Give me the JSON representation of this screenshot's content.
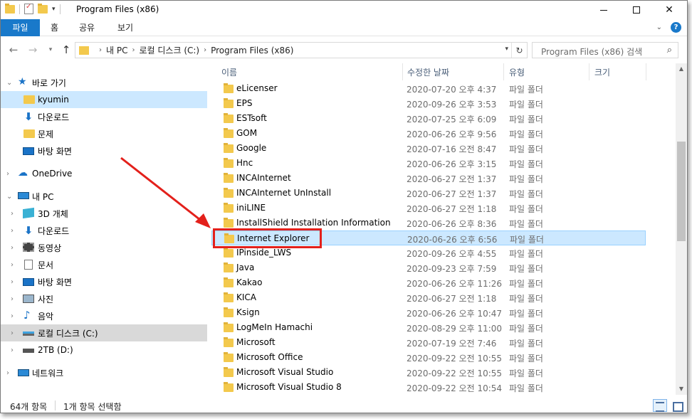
{
  "window": {
    "title": "Program Files (x86)"
  },
  "ribbon": {
    "tabs": [
      "파일",
      "홈",
      "공유",
      "보기"
    ]
  },
  "address": {
    "crumbs": [
      "내 PC",
      "로컬 디스크 (C:)",
      "Program Files (x86)"
    ],
    "search_placeholder": "Program Files (x86) 검색"
  },
  "nav": {
    "quick_access": "바로 가기",
    "quick_items": [
      "kyumin",
      "다운로드",
      "문제",
      "바탕 화면"
    ],
    "onedrive": "OneDrive",
    "this_pc": "내 PC",
    "pc_items": [
      "3D 개체",
      "다운로드",
      "동영상",
      "문서",
      "바탕 화면",
      "사진",
      "음악",
      "로컬 디스크 (C:)",
      "2TB (D:)"
    ],
    "network": "네트워크"
  },
  "columns": {
    "name": "이름",
    "date": "수정한 날짜",
    "type": "유형",
    "size": "크기"
  },
  "files": [
    {
      "name": "eLicenser",
      "date": "2020-07-20 오후 4:37",
      "type": "파일 폴더"
    },
    {
      "name": "EPS",
      "date": "2020-09-26 오후 3:53",
      "type": "파일 폴더"
    },
    {
      "name": "ESTsoft",
      "date": "2020-07-25 오후 6:09",
      "type": "파일 폴더"
    },
    {
      "name": "GOM",
      "date": "2020-06-26 오후 9:56",
      "type": "파일 폴더"
    },
    {
      "name": "Google",
      "date": "2020-07-16 오전 8:47",
      "type": "파일 폴더"
    },
    {
      "name": "Hnc",
      "date": "2020-06-26 오후 3:15",
      "type": "파일 폴더"
    },
    {
      "name": "INCAInternet",
      "date": "2020-06-27 오전 1:37",
      "type": "파일 폴더"
    },
    {
      "name": "INCAInternet UnInstall",
      "date": "2020-06-27 오전 1:37",
      "type": "파일 폴더"
    },
    {
      "name": "iniLINE",
      "date": "2020-06-27 오전 1:18",
      "type": "파일 폴더"
    },
    {
      "name": "InstallShield Installation Information",
      "date": "2020-06-26 오후 8:36",
      "type": "파일 폴더"
    },
    {
      "name": "Internet Explorer",
      "date": "2020-06-26 오후 6:56",
      "type": "파일 폴더"
    },
    {
      "name": "IPinside_LWS",
      "date": "2020-09-26 오후 4:55",
      "type": "파일 폴더"
    },
    {
      "name": "Java",
      "date": "2020-09-23 오후 7:59",
      "type": "파일 폴더"
    },
    {
      "name": "Kakao",
      "date": "2020-06-26 오후 11:26",
      "type": "파일 폴더"
    },
    {
      "name": "KICA",
      "date": "2020-06-27 오전 1:18",
      "type": "파일 폴더"
    },
    {
      "name": "Ksign",
      "date": "2020-06-26 오후 10:47",
      "type": "파일 폴더"
    },
    {
      "name": "LogMeIn Hamachi",
      "date": "2020-08-29 오후 11:00",
      "type": "파일 폴더"
    },
    {
      "name": "Microsoft",
      "date": "2020-07-19 오전 7:46",
      "type": "파일 폴더"
    },
    {
      "name": "Microsoft Office",
      "date": "2020-09-22 오전 10:55",
      "type": "파일 폴더"
    },
    {
      "name": "Microsoft Visual Studio",
      "date": "2020-09-22 오전 10:55",
      "type": "파일 폴더"
    },
    {
      "name": "Microsoft Visual Studio 8",
      "date": "2020-09-22 오전 10:54",
      "type": "파일 폴더"
    }
  ],
  "selected_index": 10,
  "status": {
    "count": "64개 항목",
    "selection": "1개 항목 선택함"
  },
  "colors": {
    "accent": "#1979ca",
    "selection": "#cce8ff",
    "annotation": "#e3201b"
  }
}
